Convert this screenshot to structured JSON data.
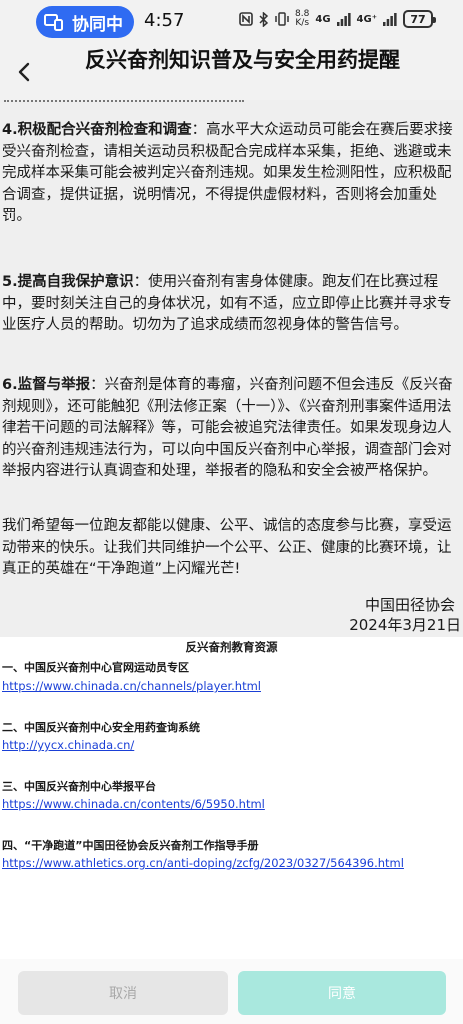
{
  "status_bar": {
    "sync_label": "协同中",
    "time": "4:57",
    "speed_value": "8.8",
    "speed_unit": "K/s",
    "net1": "4G",
    "net2": "4G⁺",
    "battery": "77"
  },
  "header": {
    "title": "反兴奋剂知识普及与安全用药提醒"
  },
  "document": {
    "p4_heading": "4.积极配合兴奋剂检查和调查",
    "p4_text": "：高水平大众运动员可能会在赛后要求接受兴奋剂检查，请相关运动员积极配合完成样本采集，拒绝、逃避或未完成样本采集可能会被判定兴奋剂违规。如果发生检测阳性，应积极配合调查，提供证据，说明情况，不得提供虚假材料，否则将会加重处罚。",
    "p5_heading": "5.提高自我保护意识",
    "p5_text": "：使用兴奋剂有害身体健康。跑友们在比赛过程中，要时刻关注自己的身体状况，如有不适，应立即停止比赛并寻求专业医疗人员的帮助。切勿为了追求成绩而忽视身体的警告信号。",
    "p6_heading": "6.监督与举报",
    "p6_text": "：兴奋剂是体育的毒瘤，兴奋剂问题不但会违反《反兴奋剂规则》，还可能触犯《刑法修正案（十一）》、《兴奋剂刑事案件适用法律若干问题的司法解释》等，可能会被追究法律责任。如果发现身边人的兴奋剂违规违法行为，可以向中国反兴奋剂中心举报，调查部门会对举报内容进行认真调查和处理，举报者的隐私和安全会被严格保护。",
    "closing": "我们希望每一位跑友都能以健康、公平、诚信的态度参与比赛，享受运动带来的快乐。让我们共同维护一个公平、公正、健康的比赛环境，让真正的英雄在“干净跑道”上闪耀光芒!",
    "signature_org": "中国田径协会",
    "signature_date": "2024年3月21日"
  },
  "resources": {
    "title": "反兴奋剂教育资源",
    "items": [
      {
        "heading": "一、中国反兴奋剂中心官网运动员专区",
        "url": "https://www.chinada.cn/channels/player.html"
      },
      {
        "heading": "二、中国反兴奋剂中心安全用药查询系统",
        "url": "http://yycx.chinada.cn/"
      },
      {
        "heading": "三、中国反兴奋剂中心举报平台",
        "url": "https://www.chinada.cn/contents/6/5950.html"
      },
      {
        "heading": "四、“干净跑道”中国田径协会反兴奋剂工作指导手册",
        "url": "https://www.athletics.org.cn/anti-doping/zcfg/2023/0327/564396.html"
      }
    ]
  },
  "actions": {
    "cancel_label": "取消",
    "agree_label": "同意"
  },
  "colors": {
    "sync_pill": "#2f6bf2",
    "link": "#1a3fd6",
    "agree_button": "#a9e8de",
    "cancel_button": "#e6e6e6"
  },
  "icons": [
    "collaboration-icon",
    "nfc-icon",
    "bluetooth-icon",
    "vibrate-icon",
    "signal-icon",
    "battery-icon",
    "back-arrow-icon"
  ]
}
